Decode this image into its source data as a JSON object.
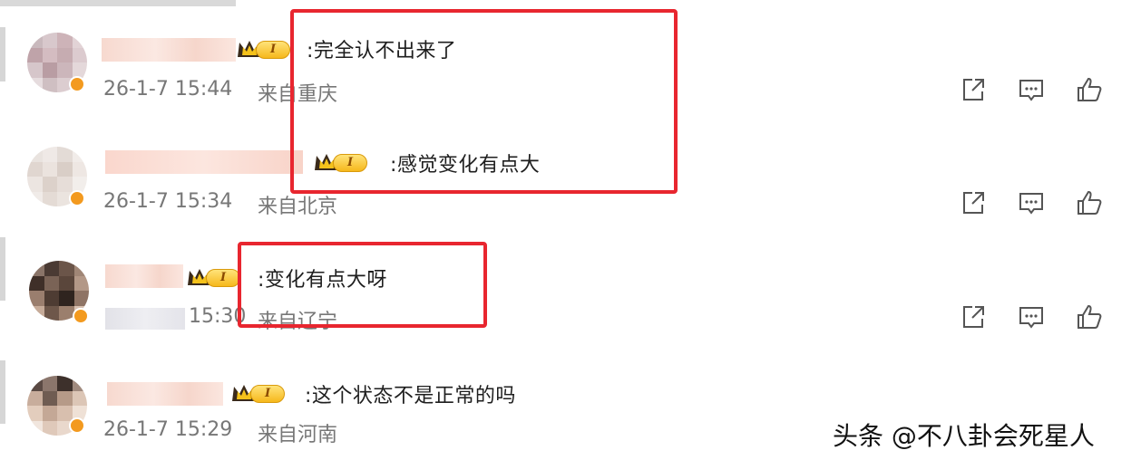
{
  "comments": [
    {
      "text": ":完全认不出来了",
      "time": "26-1-7 15:44",
      "location": "来自重庆",
      "level": "I"
    },
    {
      "text": ":感觉变化有点大",
      "time": "26-1-7 15:34",
      "location": "来自北京",
      "level": "I"
    },
    {
      "text": ":变化有点大呀",
      "time": "15:30",
      "location": "来自辽宁",
      "level": "I"
    },
    {
      "text": ":这个状态不是正常的吗",
      "time": "26-1-7 15:29",
      "location": "来自河南",
      "level": "I"
    }
  ],
  "icons": {
    "share": "share-icon",
    "comment": "comment-icon",
    "like": "thumbs-up-icon",
    "crown": "crown-icon",
    "verified": "verified-badge-icon"
  },
  "colors": {
    "highlight_box": "#e8262f",
    "meta_text": "#777777",
    "level_badge": "#f6b81c",
    "verified_badge": "#f39a1f"
  },
  "watermark": "头条 @不八卦会死星人"
}
